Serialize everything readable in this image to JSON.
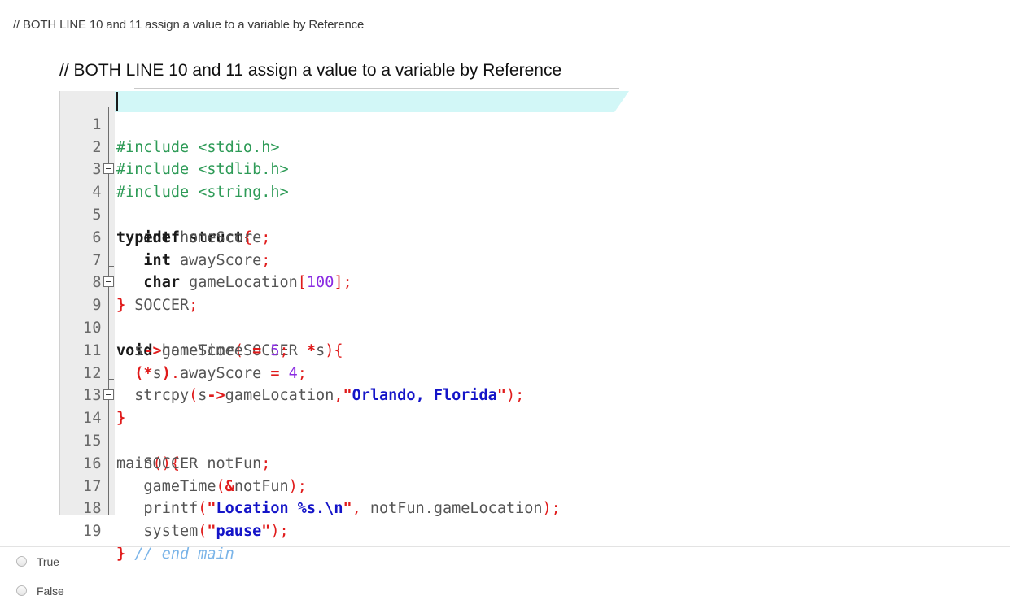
{
  "question": {
    "prompt": "// BOTH LINE 10 and 11 assign a value to a variable by Reference",
    "body_heading": "// BOTH LINE 10 and 11 assign a value to a variable by Reference"
  },
  "code": {
    "language": "C",
    "current_line": 1,
    "colors": {
      "preprocessor": "#2e9b57",
      "keyword": "#1a1a1a",
      "identifier": "#555555",
      "punctuation": "#e01b1b",
      "operator": "#e01b1b",
      "number": "#8a2be2",
      "string": "#1414c8",
      "comment": "#7ab4e8",
      "gutter_background": "#ececec",
      "current_line_highlight": "#d2f7f7"
    },
    "lines": [
      {
        "n": "1",
        "text": "#include <stdio.h>"
      },
      {
        "n": "2",
        "text": "#include <stdlib.h>"
      },
      {
        "n": "3",
        "text": "#include <string.h>"
      },
      {
        "n": "4",
        "text": "typedef struct{"
      },
      {
        "n": "5",
        "text": "    int homeScore;"
      },
      {
        "n": "6",
        "text": "    int awayScore;"
      },
      {
        "n": "7",
        "text": "    char gameLocation[100];"
      },
      {
        "n": "8",
        "text": "} SOCCER;"
      },
      {
        "n": "9",
        "text": "void gameTime(SOCCER *s){"
      },
      {
        "n": "10",
        "text": "   s->homeScore = 5;"
      },
      {
        "n": "11",
        "text": "   (*s).awayScore = 4;"
      },
      {
        "n": "12",
        "text": "   strcpy(s->gameLocation,\"Orlando, Florida\");"
      },
      {
        "n": "13",
        "text": "}"
      },
      {
        "n": "14",
        "text": "main(){"
      },
      {
        "n": "15",
        "text": "    SOCCER notFun;"
      },
      {
        "n": "16",
        "text": "    gameTime(&notFun);"
      },
      {
        "n": "17",
        "text": "    printf(\"Location %s.\\n\", notFun.gameLocation);"
      },
      {
        "n": "18",
        "text": "    system(\"pause\");"
      },
      {
        "n": "19",
        "text": "} // end main"
      }
    ],
    "fold_regions": [
      {
        "start": 4,
        "end": 8
      },
      {
        "start": 9,
        "end": 13
      },
      {
        "start": 14,
        "end": 19
      }
    ]
  },
  "answers": {
    "options": [
      {
        "label": "True",
        "selected": false
      },
      {
        "label": "False",
        "selected": false
      }
    ]
  }
}
